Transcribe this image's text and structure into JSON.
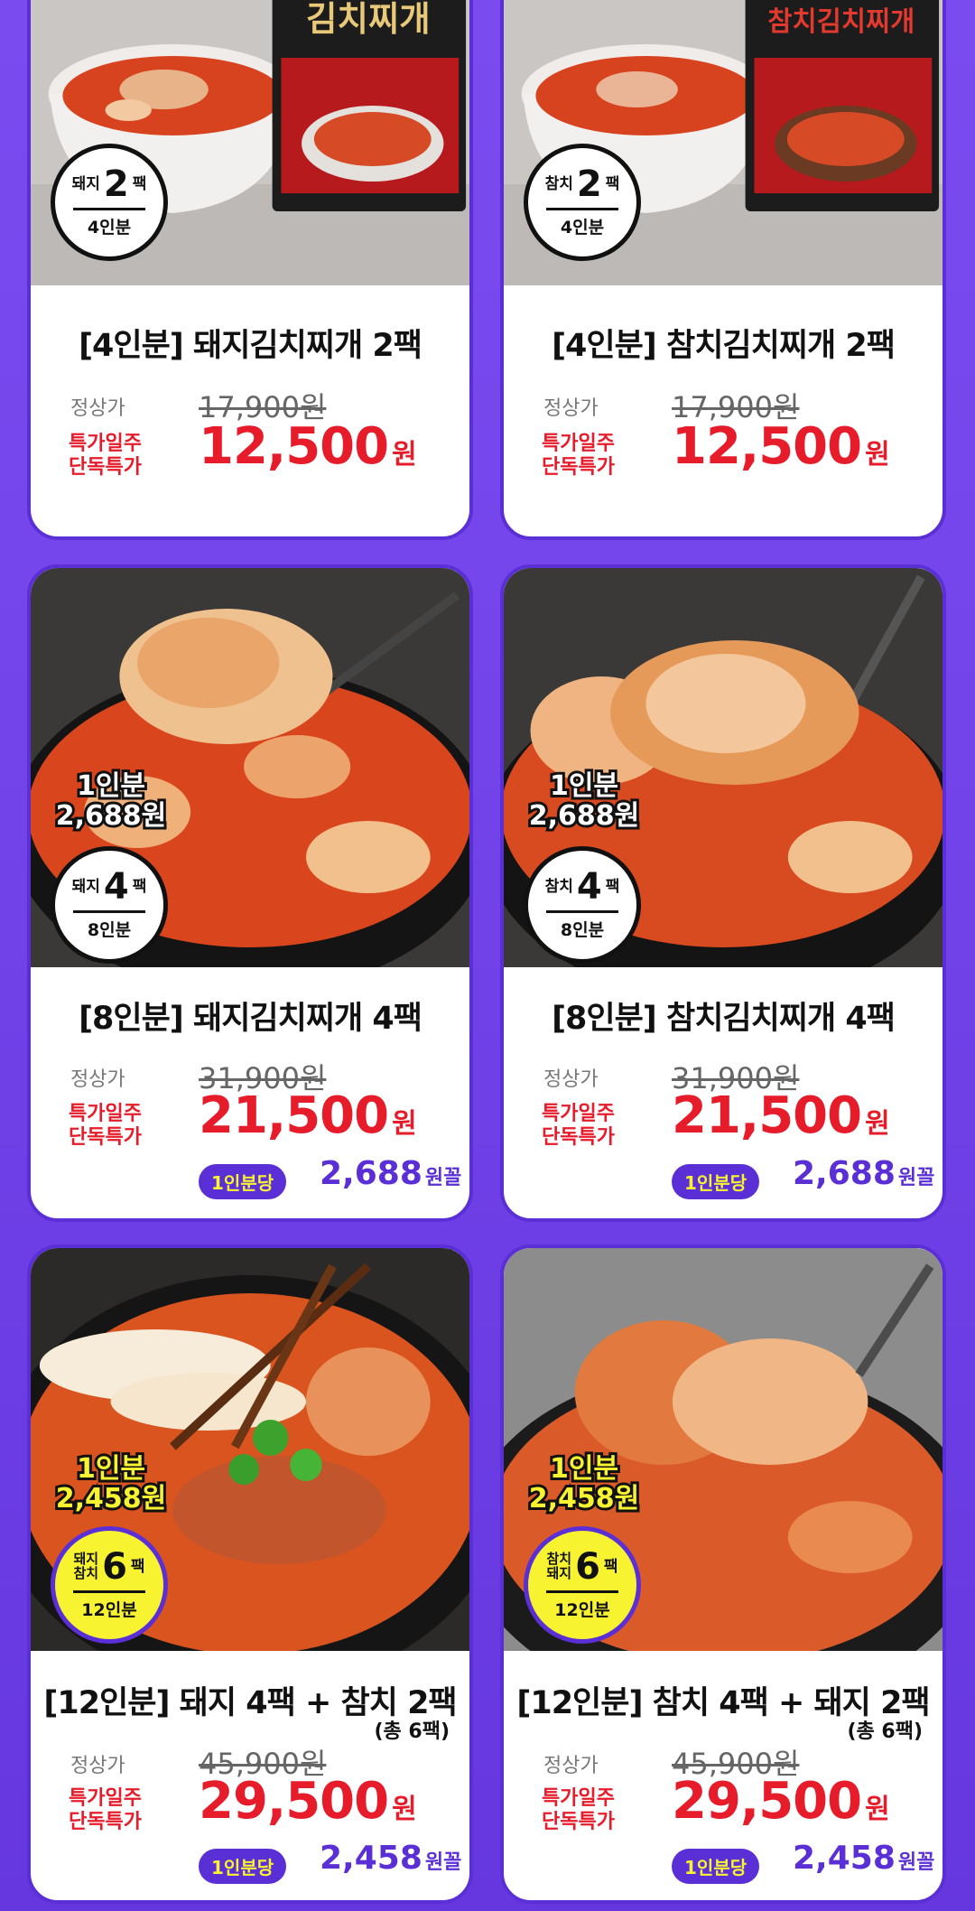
{
  "cards": [
    {
      "title": "[4인분] 돼지김치찌개 2팩",
      "badge": {
        "type": "돼지",
        "count": "2",
        "unit": "팩",
        "servings": "4인분"
      },
      "regular_label": "정상가",
      "regular_price": "17,900원",
      "sale_label_1": "특가일주",
      "sale_label_2": "단독특가",
      "sale_price": "12,500",
      "won": "원"
    },
    {
      "title": "[4인분] 참치김치찌개 2팩",
      "badge": {
        "type": "참치",
        "count": "2",
        "unit": "팩",
        "servings": "4인분"
      },
      "regular_label": "정상가",
      "regular_price": "17,900원",
      "sale_label_1": "특가일주",
      "sale_label_2": "단독특가",
      "sale_price": "12,500",
      "won": "원"
    },
    {
      "title": "[8인분] 돼지김치찌개 4팩",
      "unit_price_1": "1인분",
      "unit_price_2": "2,688원",
      "badge": {
        "type": "돼지",
        "count": "4",
        "unit": "팩",
        "servings": "8인분"
      },
      "regular_label": "정상가",
      "regular_price": "31,900원",
      "sale_label_1": "특가일주",
      "sale_label_2": "단독특가",
      "sale_price": "21,500",
      "won": "원",
      "per_label": "1인분당",
      "per_price": "2,688",
      "per_suffix": "원꼴"
    },
    {
      "title": "[8인분] 참치김치찌개 4팩",
      "unit_price_1": "1인분",
      "unit_price_2": "2,688원",
      "badge": {
        "type": "참치",
        "count": "4",
        "unit": "팩",
        "servings": "8인분"
      },
      "regular_label": "정상가",
      "regular_price": "31,900원",
      "sale_label_1": "특가일주",
      "sale_label_2": "단독특가",
      "sale_price": "21,500",
      "won": "원",
      "per_label": "1인분당",
      "per_price": "2,688",
      "per_suffix": "원꼴"
    },
    {
      "title": "[12인분] 돼지 4팩 + 참치 2팩",
      "note": "(총 6팩)",
      "unit_price_1": "1인분",
      "unit_price_2": "2,458원",
      "badge": {
        "type_top": "돼지",
        "type_bottom": "참치",
        "count": "6",
        "unit": "팩",
        "servings": "12인분"
      },
      "regular_label": "정상가",
      "regular_price": "45,900원",
      "sale_label_1": "특가일주",
      "sale_label_2": "단독특가",
      "sale_price": "29,500",
      "won": "원",
      "per_label": "1인분당",
      "per_price": "2,458",
      "per_suffix": "원꼴"
    },
    {
      "title": "[12인분] 참치 4팩 + 돼지 2팩",
      "note": "(총 6팩)",
      "unit_price_1": "1인분",
      "unit_price_2": "2,458원",
      "badge": {
        "type_top": "참치",
        "type_bottom": "돼지",
        "count": "6",
        "unit": "팩",
        "servings": "12인분"
      },
      "regular_label": "정상가",
      "regular_price": "45,900원",
      "sale_label_1": "특가일주",
      "sale_label_2": "단독특가",
      "sale_price": "29,500",
      "won": "원",
      "per_label": "1인분당",
      "per_price": "2,458",
      "per_suffix": "원꼴"
    }
  ],
  "package_text": {
    "left": "김치찌개",
    "right": "참치김치찌개"
  }
}
